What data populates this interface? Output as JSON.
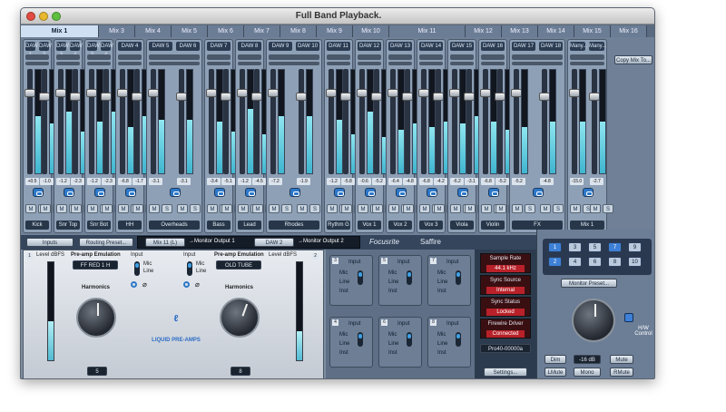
{
  "window": {
    "title": "Full Band Playback."
  },
  "tabs": [
    {
      "label": "Mix 1",
      "active": true
    },
    {
      "label": "Mix 3"
    },
    {
      "label": "Mix 4"
    },
    {
      "label": "Mix 5"
    },
    {
      "label": "Mix 6"
    },
    {
      "label": "Mix 7"
    },
    {
      "label": "Mix 8"
    },
    {
      "label": "Mix 9"
    },
    {
      "label": "Mix 10"
    },
    {
      "label": "Mix 11"
    },
    {
      "label": "Mix 12"
    },
    {
      "label": "Mix 13"
    },
    {
      "label": "Mix 14"
    },
    {
      "label": "Mix 15"
    },
    {
      "label": "Mix 16"
    }
  ],
  "channels": [
    {
      "names": [
        "DAW 1",
        "DAW 2"
      ],
      "values": [
        "+0.5",
        "-1.0"
      ],
      "label": "Kick",
      "levels": [
        0.55,
        0.48
      ]
    },
    {
      "names": [
        "DAW 3",
        "DAW 4"
      ],
      "values": [
        "-1.2",
        "-2.3"
      ],
      "label": "Snr Top",
      "levels": [
        0.6,
        0.4
      ]
    },
    {
      "names": [
        "DAW 3",
        "DAW 4"
      ],
      "values": [
        "-1.2",
        "-2.3"
      ],
      "label": "Snr Bot",
      "levels": [
        0.5,
        0.6
      ]
    },
    {
      "names": [
        "DAW 4"
      ],
      "values": [
        "-6.8",
        "-1.7"
      ],
      "label": "HH",
      "levels": [
        0.45,
        0.55
      ]
    },
    {
      "names": [
        "DAW 5",
        "DAW 6"
      ],
      "values": [
        "-3.1",
        "-3.1"
      ],
      "label": "Overheads",
      "levels": [
        0.52,
        0.52
      ]
    },
    {
      "names": [
        "DAW 7"
      ],
      "values": [
        "-3.4",
        "-5.1"
      ],
      "label": "Bass",
      "levels": [
        0.5,
        0.4
      ]
    },
    {
      "names": [
        "DAW 8"
      ],
      "values": [
        "-1.2",
        "-4.5"
      ],
      "label": "Lead",
      "levels": [
        0.62,
        0.38
      ]
    },
    {
      "names": [
        "DAW 9",
        "DAW 10"
      ],
      "values": [
        "-7.2",
        "-1.9"
      ],
      "label": "Rhodes",
      "levels": [
        0.55,
        0.55
      ]
    },
    {
      "names": [
        "DAW 11"
      ],
      "values": [
        "-1.2",
        "-5.8"
      ],
      "label": "Rythm G",
      "levels": [
        0.52,
        0.38
      ]
    },
    {
      "names": [
        "DAW 12"
      ],
      "values": [
        "-0.6",
        "-5.2"
      ],
      "label": "Vox 1",
      "levels": [
        0.6,
        0.35
      ]
    },
    {
      "names": [
        "DAW 13"
      ],
      "values": [
        "-6.4",
        "-4.8"
      ],
      "label": "Vox 2",
      "levels": [
        0.42,
        0.48
      ]
    },
    {
      "names": [
        "DAW 14"
      ],
      "values": [
        "-6.8",
        "-4.2"
      ],
      "label": "Vox 3",
      "levels": [
        0.45,
        0.5
      ]
    },
    {
      "names": [
        "DAW 15"
      ],
      "values": [
        "-6.2",
        "-3.1"
      ],
      "label": "Viola",
      "levels": [
        0.48,
        0.55
      ]
    },
    {
      "names": [
        "DAW 16"
      ],
      "values": [
        "-6.8",
        "-5.2"
      ],
      "label": "Violin",
      "levels": [
        0.5,
        0.42
      ]
    },
    {
      "names": [
        "DAW 17",
        "DAW 18"
      ],
      "values": [
        "-5.2",
        "-4.8"
      ],
      "label": "FX",
      "levels": [
        0.45,
        0.5
      ]
    },
    {
      "names": [
        "Many...",
        "Many..."
      ],
      "values": [
        "-15.0",
        "-2.7"
      ],
      "label": "Mix 1",
      "levels": [
        0.5,
        0.5
      ]
    }
  ],
  "copy_mix": "Copy Mix To...",
  "routing_bar": {
    "inputs": "Inputs",
    "routing_preset": "Routing Preset...",
    "mix_source": "Mix 11 (L)",
    "arrow1": "→Monitor Output 1",
    "daw_source": "DAW 2",
    "arrow2": "→Monitor Output 2"
  },
  "brand": {
    "focusrite": "Focusrite",
    "saffire": "Saffire"
  },
  "preamp": {
    "left": {
      "num": "1",
      "level_label": "Level dBFS",
      "emulation_label": "Pre-amp Emulation",
      "emulation": "FF RED 1 H",
      "input_label": "Input",
      "harmonics_label": "Harmonics",
      "harmonics": "5",
      "mic": "Mic",
      "line": "Line"
    },
    "right": {
      "num": "2",
      "level_label": "Level dBFS",
      "emulation_label": "Pre-amp Emulation",
      "emulation": "OLD TUBE",
      "input_label": "Input",
      "harmonics_label": "Harmonics",
      "harmonics": "8",
      "mic": "Mic",
      "line": "Line"
    },
    "logo": "LIQUID PRE-AMPS"
  },
  "inputs": [
    {
      "num": "3",
      "opts": [
        "Mic",
        "Line",
        "Inst"
      ],
      "label": "Input"
    },
    {
      "num": "5",
      "opts": [
        "Mic",
        "Line",
        "Inst"
      ],
      "label": "Input"
    },
    {
      "num": "7",
      "opts": [
        "Mic",
        "Line",
        "Inst"
      ],
      "label": "Input"
    },
    {
      "num": "4",
      "opts": [
        "Mic",
        "Line",
        "Inst"
      ],
      "label": "Input"
    },
    {
      "num": "6",
      "opts": [
        "Mic",
        "Line",
        "Inst"
      ],
      "label": "Input"
    },
    {
      "num": "8",
      "opts": [
        "Mic",
        "Line",
        "Inst"
      ],
      "label": "Input"
    }
  ],
  "device": {
    "sample_rate_label": "Sample Rate",
    "sample_rate": "44.1 kHz",
    "sync_source_label": "Sync Source",
    "sync_source": "Internal",
    "sync_status_label": "Sync Status",
    "sync_status": "Locked",
    "firewire_label": "Firewire Driver",
    "firewire": "Connected",
    "model": "Pro40-00000a",
    "settings": "Settings..."
  },
  "monitor": {
    "buttons": [
      "1",
      "3",
      "5",
      "7",
      "9",
      "2",
      "4",
      "6",
      "8",
      "10"
    ],
    "preset": "Monitor Preset...",
    "hw_control": "H/W Control",
    "dim": "Dim",
    "level": "-16 dB",
    "mute": "Mute",
    "lmute": "LMute",
    "mono": "Mono",
    "rmute": "RMute"
  },
  "colors": {
    "accent": "#3d80d6",
    "meter": "#53bbd3",
    "status_red": "#b82129"
  }
}
